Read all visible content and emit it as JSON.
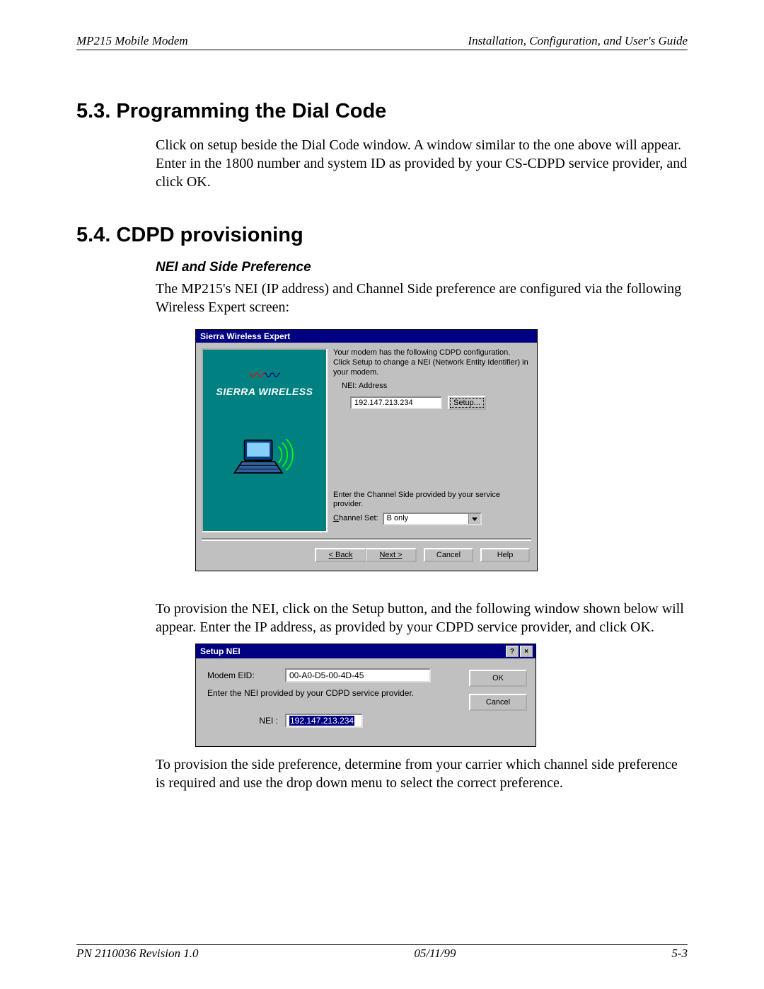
{
  "header": {
    "left": "MP215 Mobile Modem",
    "right": "Installation, Configuration, and User's Guide"
  },
  "section53": {
    "title": "5.3.   Programming the Dial Code",
    "body": "Click on setup beside the Dial Code window.  A window similar to the one above will appear. Enter in the 1800 number and system ID as provided by your CS-CDPD service provider, and click OK."
  },
  "section54": {
    "title": "5.4.   CDPD provisioning",
    "sub": "NEI and Side Preference",
    "intro": "The MP215's NEI (IP address) and Channel Side preference are configured via the following Wireless Expert screen:"
  },
  "wizard": {
    "title": "Sierra Wireless Expert",
    "brand": "SIERRA WIRELESS",
    "instr": "Your modem has the following CDPD configuration. Click Setup to change a NEI (Network Entity Identifier) in your modem.",
    "nei_label": "NEI: Address",
    "nei_value": "192.147.213.234",
    "setup_btn": "Setup...",
    "channel_instr": "Enter the Channel Side provided by your service provider.",
    "channel_label_pre": "C",
    "channel_label_post": "hannel Set:",
    "channel_value": "B only",
    "back": "< Back",
    "next": "Next >",
    "cancel": "Cancel",
    "help": "Help"
  },
  "mid_para": "To provision the NEI, click on the Setup button, and the following window shown below will appear.  Enter the IP address, as provided by your CDPD service provider, and click OK.",
  "dlg": {
    "title": "Setup NEI",
    "help_glyph": "?",
    "close_glyph": "×",
    "eid_label": "Modem EID:",
    "eid_value": "00-A0-D5-00-4D-45",
    "hint": "Enter the NEI provided by your CDPD service provider.",
    "nei_label": "NEI :",
    "nei_value": "192.147.213.234",
    "ok": "OK",
    "cancel": "Cancel"
  },
  "tail_para": "To provision the side preference, determine from your carrier which channel side preference is required and use the drop down menu to select the correct preference.",
  "footer": {
    "left": "PN 2110036 Revision 1.0",
    "center": "05/11/99",
    "right": "5-3"
  }
}
